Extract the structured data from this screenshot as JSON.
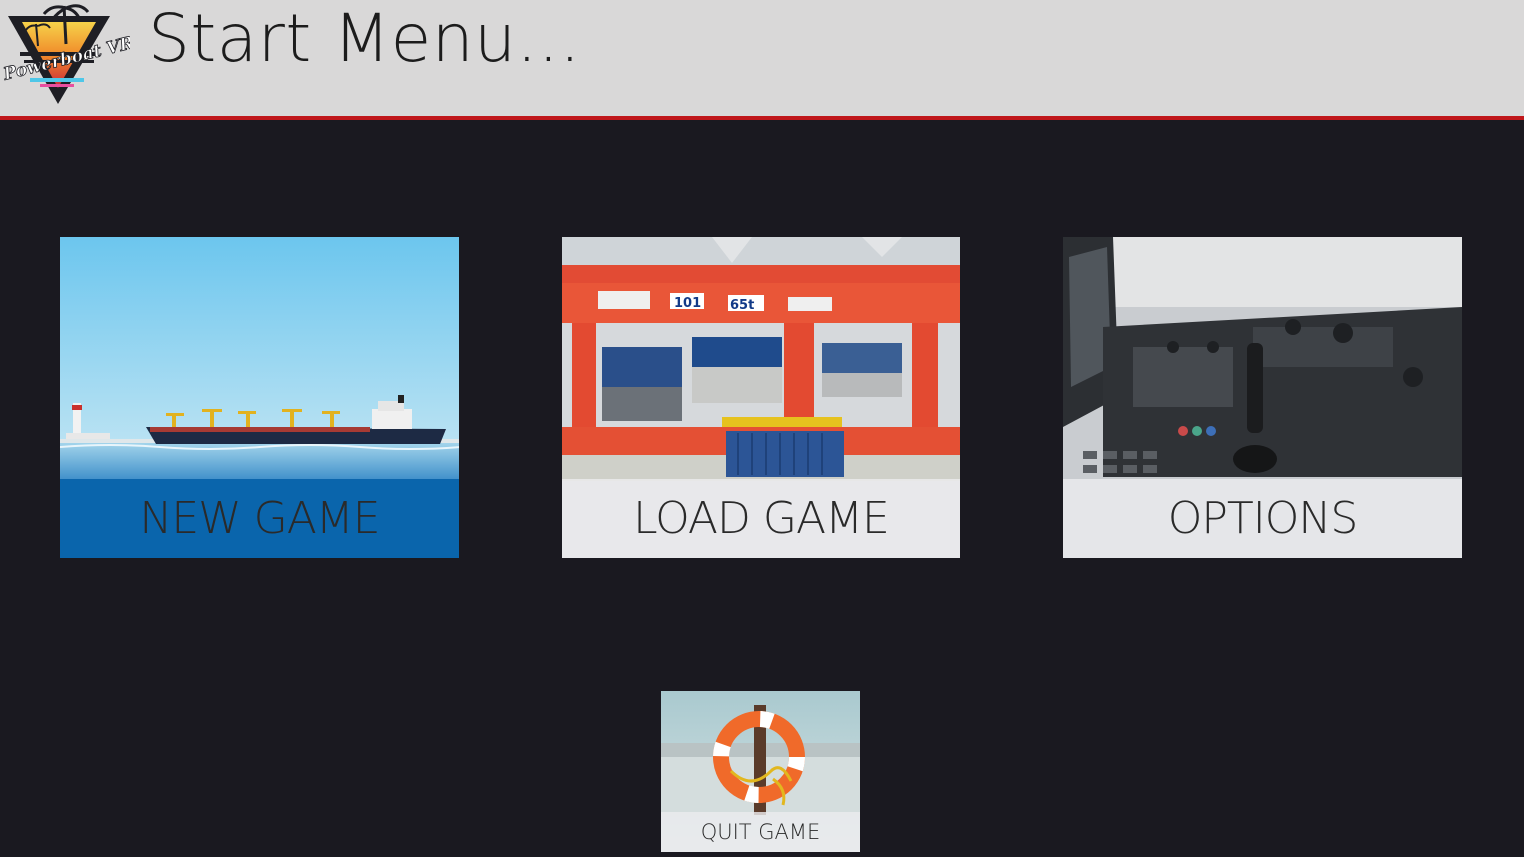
{
  "app": {
    "title": "Start Menu...",
    "logo_text": "Powerboat VR"
  },
  "menu": {
    "new_game": {
      "label": "NEW GAME",
      "image": "cargo-ship-at-sea"
    },
    "load_game": {
      "label": "LOAD GAME",
      "image": "container-port-crane"
    },
    "options": {
      "label": "OPTIONS",
      "image": "ship-bridge-controls"
    },
    "quit_game": {
      "label": "QUIT GAME",
      "image": "life-ring-buoy"
    }
  },
  "colors": {
    "header_bg": "#d9d8d8",
    "header_accent": "#c0171b",
    "page_bg": "#1a1920",
    "selected_band": "#0a65ac",
    "band_light": "#ebebee"
  }
}
